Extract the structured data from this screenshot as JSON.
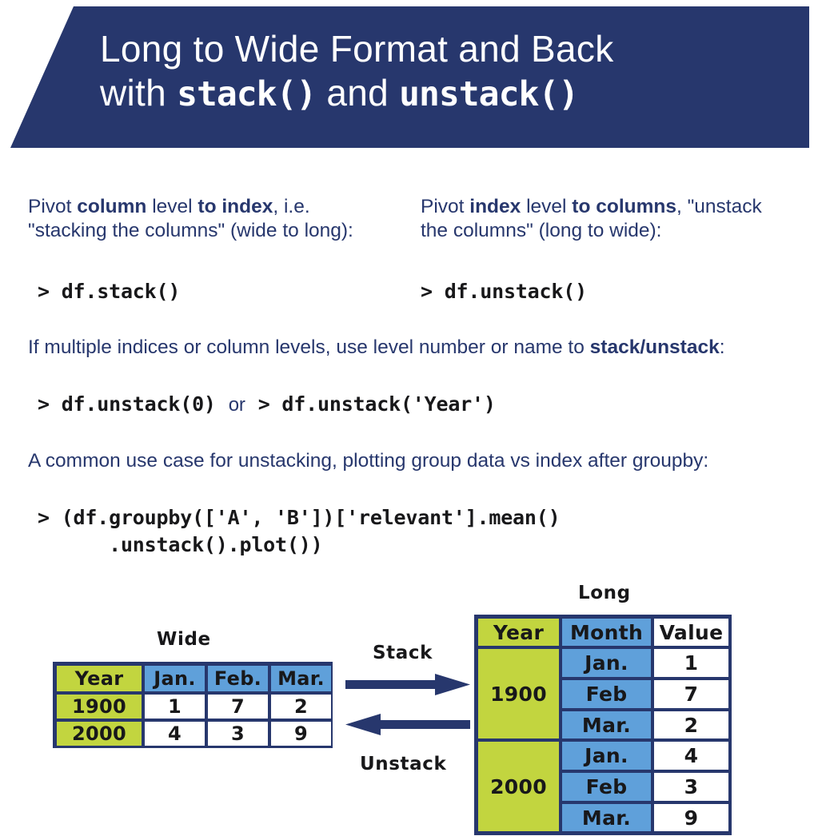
{
  "header": {
    "line1": "Long to Wide Format and Back",
    "line2_pre": "with ",
    "line2_code1": "stack()",
    "line2_mid": " and ",
    "line2_code2": "unstack()",
    "bg_color": "#27376D"
  },
  "columns": {
    "left": {
      "t1": "Pivot ",
      "b1": "column",
      "t2": " level ",
      "b2": "to index",
      "t3": ", i.e. \"stacking the columns\" (wide to long):",
      "code": "> df.stack()"
    },
    "right": {
      "t1": "Pivot ",
      "b1": "index",
      "t2": " level ",
      "b2": "to columns",
      "t3": ", \"unstack the columns\" (long to wide):",
      "code": "> df.unstack()"
    }
  },
  "block2": {
    "t1": "If multiple indices or column levels, use level number or name to ",
    "b1": "stack/unstack",
    "t2": ":",
    "code_a": "> df.unstack(0)",
    "or": "or",
    "code_b": "> df.unstack('Year')"
  },
  "block3": {
    "t1": "A common use case for unstacking, plotting group data vs index after groupby:",
    "code_line1": "> (df.groupby(['A', 'B'])['relevant'].mean()",
    "code_line2": "      .unstack().plot())"
  },
  "diagram": {
    "wide_caption": "Wide",
    "long_caption": "Long",
    "stack_label": "Stack",
    "unstack_label": "Unstack",
    "colors": {
      "green": "#C2D53F",
      "blue": "#5FA0DA",
      "border": "#27376D",
      "white": "#FFFFFF"
    },
    "wide_table": {
      "headers": [
        "Year",
        "Jan.",
        "Feb.",
        "Mar."
      ],
      "rows": [
        [
          "1900",
          "1",
          "7",
          "2"
        ],
        [
          "2000",
          "4",
          "3",
          "9"
        ]
      ]
    },
    "long_table": {
      "headers": [
        "Year",
        "Month",
        "Value"
      ],
      "groups": [
        {
          "year": "1900",
          "rows": [
            [
              "Jan.",
              "1"
            ],
            [
              "Feb",
              "7"
            ],
            [
              "Mar.",
              "2"
            ]
          ]
        },
        {
          "year": "2000",
          "rows": [
            [
              "Jan.",
              "4"
            ],
            [
              "Feb",
              "3"
            ],
            [
              "Mar.",
              "9"
            ]
          ]
        }
      ]
    }
  }
}
